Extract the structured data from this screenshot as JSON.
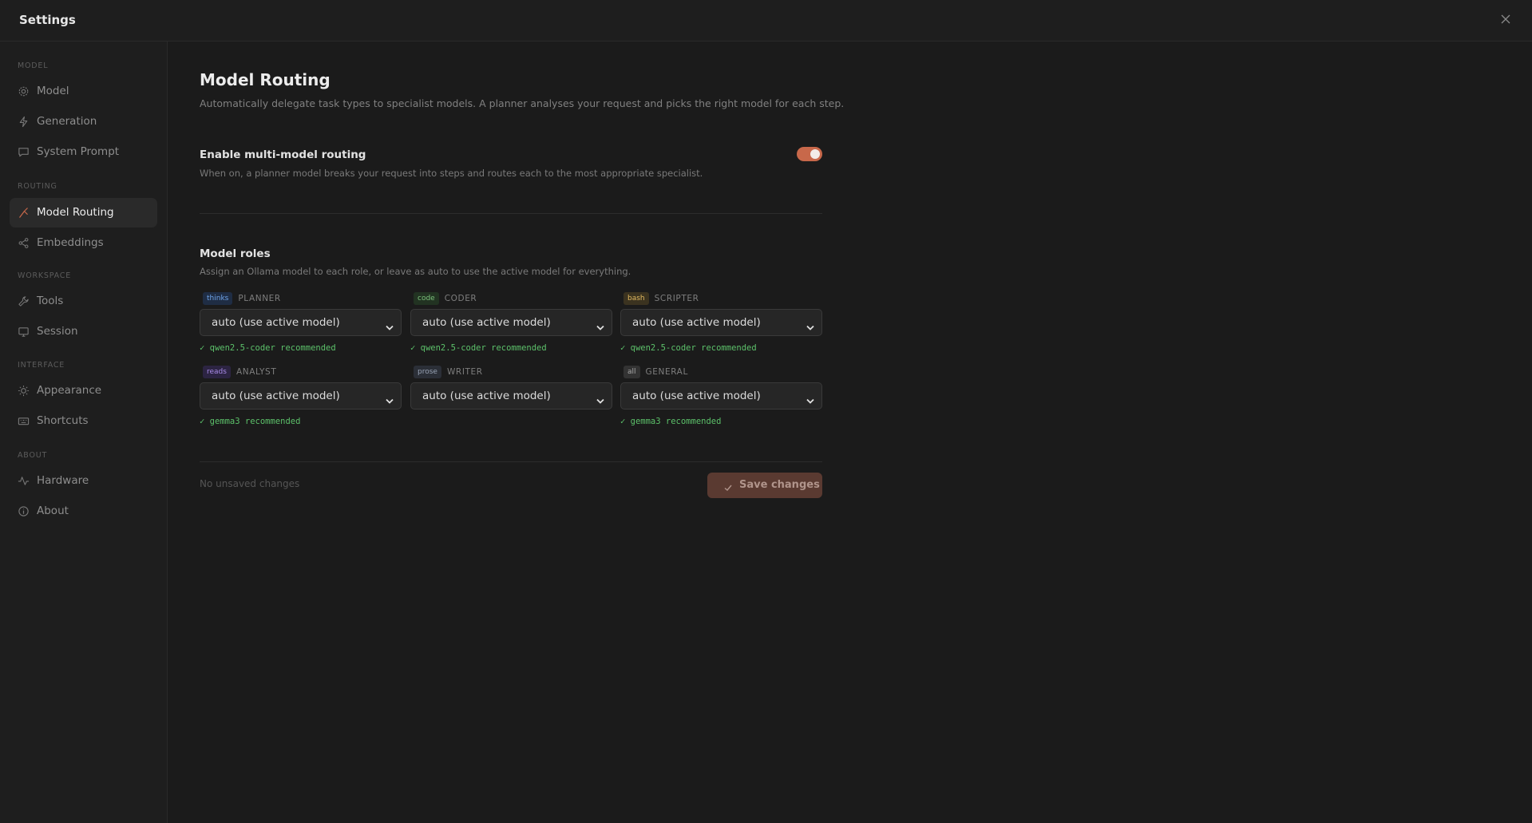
{
  "window": {
    "title": "Settings"
  },
  "sidebar": {
    "sections": [
      {
        "label": "MODEL",
        "items": [
          {
            "label": "Model",
            "icon": "gear-icon"
          },
          {
            "label": "Generation",
            "icon": "bolt-icon"
          },
          {
            "label": "System Prompt",
            "icon": "chat-icon"
          }
        ]
      },
      {
        "label": "ROUTING",
        "items": [
          {
            "label": "Model Routing",
            "icon": "route-icon",
            "active": true
          },
          {
            "label": "Embeddings",
            "icon": "share-icon"
          }
        ]
      },
      {
        "label": "WORKSPACE",
        "items": [
          {
            "label": "Tools",
            "icon": "wrench-icon"
          },
          {
            "label": "Session",
            "icon": "monitor-icon"
          }
        ]
      },
      {
        "label": "INTERFACE",
        "items": [
          {
            "label": "Appearance",
            "icon": "sun-icon"
          },
          {
            "label": "Shortcuts",
            "icon": "keyboard-icon"
          }
        ]
      },
      {
        "label": "ABOUT",
        "items": [
          {
            "label": "Hardware",
            "icon": "activity-icon"
          },
          {
            "label": "About",
            "icon": "info-icon"
          }
        ]
      }
    ]
  },
  "main": {
    "title": "Model Routing",
    "subtitle": "Automatically delegate task types to specialist models. A planner analyses your request and picks the right model for each step.",
    "routing_toggle": {
      "label": "Enable multi-model routing",
      "description": "When on, a planner model breaks your request into steps and routes each to the most appropriate specialist.",
      "enabled": true
    },
    "roles_section": {
      "title": "Model roles",
      "description": "Assign an Ollama model to each role, or leave as auto to use the active model for everything."
    },
    "roles": [
      {
        "tag": "thinks",
        "name": "PLANNER",
        "value": "auto (use active model)",
        "recommendation": "✓ qwen2.5-coder recommended",
        "tag_bg": "#1f2d44",
        "tag_fg": "#6fa3e8"
      },
      {
        "tag": "code",
        "name": "CODER",
        "value": "auto (use active model)",
        "recommendation": "✓ qwen2.5-coder recommended",
        "tag_bg": "#223322",
        "tag_fg": "#7cc27c"
      },
      {
        "tag": "bash",
        "name": "SCRIPTER",
        "value": "auto (use active model)",
        "recommendation": "✓ qwen2.5-coder recommended",
        "tag_bg": "#3b3320",
        "tag_fg": "#e0b860"
      },
      {
        "tag": "reads",
        "name": "ANALYST",
        "value": "auto (use active model)",
        "recommendation": "✓ gemma3 recommended",
        "tag_bg": "#2c2442",
        "tag_fg": "#a98be8"
      },
      {
        "tag": "prose",
        "name": "WRITER",
        "value": "auto (use active model)",
        "recommendation": "",
        "tag_bg": "#2b2f37",
        "tag_fg": "#98a2b4"
      },
      {
        "tag": "all",
        "name": "GENERAL",
        "value": "auto (use active model)",
        "recommendation": "✓ gemma3 recommended",
        "tag_bg": "#333333",
        "tag_fg": "#a8a8a8"
      }
    ],
    "footer": {
      "status": "No unsaved changes",
      "save_label": "Save changes"
    }
  },
  "colors": {
    "accent": "#c8684a",
    "success": "#5cc16a"
  }
}
